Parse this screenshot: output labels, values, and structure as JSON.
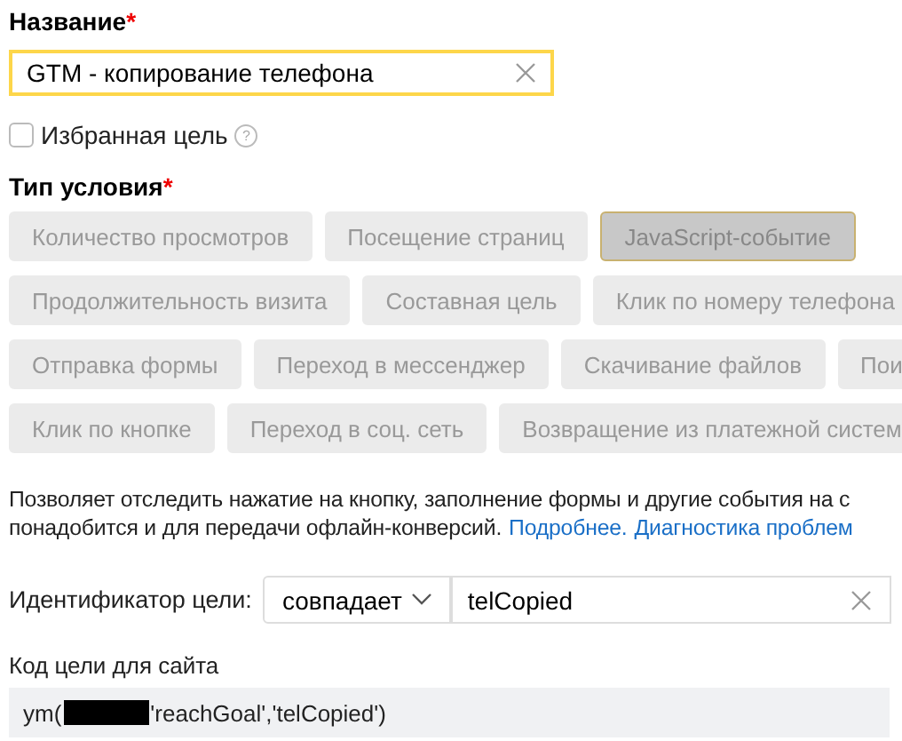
{
  "name_field": {
    "label": "Название",
    "required_mark": "*",
    "value": "GTM - копирование телефона"
  },
  "favorite": {
    "label": "Избранная цель",
    "checked": false,
    "help": "?"
  },
  "condition_type": {
    "label": "Тип условия",
    "required_mark": "*",
    "chip_rows": [
      [
        {
          "label": "Количество просмотров",
          "selected": false
        },
        {
          "label": "Посещение страниц",
          "selected": false
        },
        {
          "label": "JavaScript-событие",
          "selected": true
        }
      ],
      [
        {
          "label": "Продолжительность визита",
          "selected": false
        },
        {
          "label": "Составная цель",
          "selected": false
        },
        {
          "label": "Клик по номеру телефона",
          "selected": false
        }
      ],
      [
        {
          "label": "Отправка формы",
          "selected": false
        },
        {
          "label": "Переход в мессенджер",
          "selected": false
        },
        {
          "label": "Скачивание файлов",
          "selected": false
        },
        {
          "label": "Пои",
          "selected": false
        }
      ],
      [
        {
          "label": "Клик по кнопке",
          "selected": false
        },
        {
          "label": "Переход в соц. сеть",
          "selected": false
        },
        {
          "label": "Возвращение из платежной систем",
          "selected": false
        }
      ]
    ]
  },
  "description": {
    "lines": [
      "Позволяет отследить нажатие на кнопку, заполнение формы и другие события на с",
      "понадобится и для передачи офлайн-конверсий."
    ],
    "links": [
      "Подробнее.",
      "Диагностика проблем"
    ]
  },
  "goal_id": {
    "label": "Идентификатор цели:",
    "match": "совпадает",
    "value": "telCopied"
  },
  "site_code": {
    "label": "Код цели для сайта",
    "code_start": "ym(",
    "code_end": "'reachGoal','telCopied')"
  }
}
